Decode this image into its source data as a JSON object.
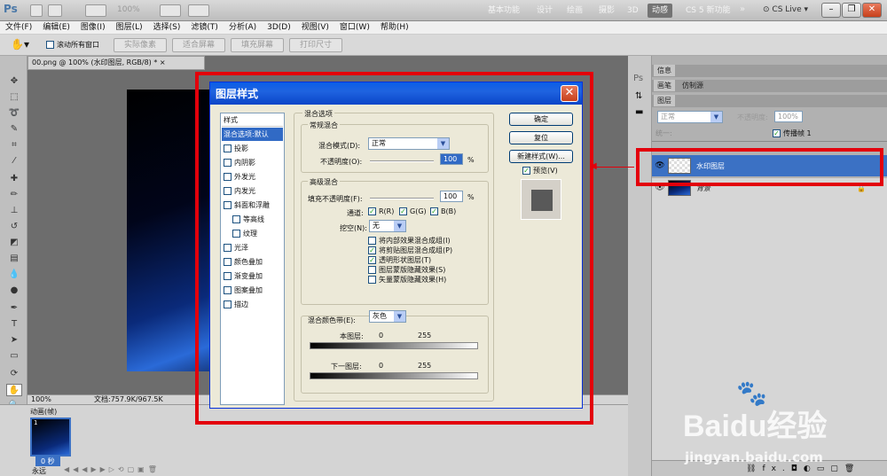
{
  "app": {
    "logo": "Ps",
    "zoom": "100%",
    "workspaces": [
      "基本功能",
      "设计",
      "绘画",
      "摄影",
      "3D",
      "动感",
      "CS 5 新功能"
    ],
    "active_workspace": "动感",
    "cslive": "CS Live"
  },
  "menu": [
    "文件(F)",
    "编辑(E)",
    "图像(I)",
    "图层(L)",
    "选择(S)",
    "滤镜(T)",
    "分析(A)",
    "3D(D)",
    "视图(V)",
    "窗口(W)",
    "帮助(H)"
  ],
  "options": {
    "scroll_all": "滚动所有窗口",
    "actual_pixels": "实际像素",
    "fit_screen": "适合屏幕",
    "fill_screen": "填充屏幕",
    "print_size": "打印尺寸"
  },
  "document": {
    "tab": "00.png @ 100% (水印图层, RGB/8) *",
    "status_zoom": "100%",
    "status_doc": "文档:757.9K/967.5K"
  },
  "animation": {
    "panel": "动画(帧)",
    "frame_num": "1",
    "frame_time": "0 秒",
    "loop": "永远"
  },
  "right": {
    "tabs1": [
      "信息"
    ],
    "tabs2": [
      "画笔",
      "仿制源"
    ],
    "layers_tab": "图层",
    "blend_mode": "正常",
    "opacity_label": "不透明度:",
    "opacity": "100%",
    "unify_label": "统一:",
    "propagate": "传播帧 1",
    "layers": [
      {
        "name": "水印图层",
        "selected": true
      },
      {
        "name": "背景",
        "selected": false
      }
    ],
    "fx_icon": "fx."
  },
  "dialog": {
    "title": "图层样式",
    "styles_header": "样式",
    "styles": [
      {
        "label": "混合选项:默认",
        "check": false,
        "active": true
      },
      {
        "label": "投影",
        "check": true
      },
      {
        "label": "内阴影",
        "check": true
      },
      {
        "label": "外发光",
        "check": true
      },
      {
        "label": "内发光",
        "check": true
      },
      {
        "label": "斜面和浮雕",
        "check": true
      },
      {
        "label": "等高线",
        "check": true,
        "sub": true
      },
      {
        "label": "纹理",
        "check": true,
        "sub": true
      },
      {
        "label": "光泽",
        "check": true
      },
      {
        "label": "颜色叠加",
        "check": true
      },
      {
        "label": "渐变叠加",
        "check": true
      },
      {
        "label": "图案叠加",
        "check": true
      },
      {
        "label": "描边",
        "check": true
      }
    ],
    "blend_options": "混合选项",
    "general_blend": "常规混合",
    "blend_mode_label": "混合模式(D):",
    "blend_mode": "正常",
    "opacity_label": "不透明度(O):",
    "opacity": "100",
    "pct": "%",
    "advanced_blend": "高级混合",
    "fill_opacity_label": "填充不透明度(F):",
    "fill_opacity": "100",
    "channels_label": "通道:",
    "channels": [
      "R(R)",
      "G(G)",
      "B(B)"
    ],
    "knockout_label": "挖空(N):",
    "knockout": "无",
    "adv_checks": [
      {
        "label": "将内部效果混合成组(I)",
        "checked": false
      },
      {
        "label": "将剪贴图层混合成组(P)",
        "checked": true
      },
      {
        "label": "透明形状图层(T)",
        "checked": true
      },
      {
        "label": "图层蒙版隐藏效果(S)",
        "checked": false
      },
      {
        "label": "矢量蒙版隐藏效果(H)",
        "checked": false
      }
    ],
    "blend_if_label": "混合颜色带(E):",
    "blend_if": "灰色",
    "this_layer": "本图层:",
    "under_layer": "下一图层:",
    "min": "0",
    "max": "255",
    "ok": "确定",
    "reset": "复位",
    "new_style": "新建样式(W)...",
    "preview": "预览(V)"
  },
  "watermark": {
    "brand": "Baidu经验",
    "url": "jingyan.baidu.com"
  },
  "colors": {
    "dialog_title": "#0a5ee8",
    "highlight": "#e3000b",
    "layer_selected": "#3b71c4"
  }
}
